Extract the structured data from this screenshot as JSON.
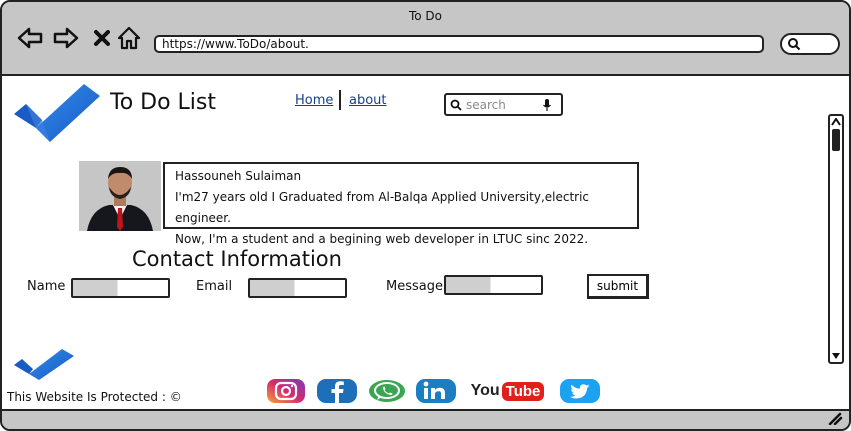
{
  "window": {
    "title": "To Do",
    "url": "https://www.ToDo/about."
  },
  "site": {
    "title": "To Do List",
    "nav": [
      {
        "label": "Home"
      },
      {
        "label": "about"
      }
    ],
    "search_placeholder": "search"
  },
  "profile": {
    "name": "Hassouneh Sulaiman",
    "line1": "I'm27 years old I Graduated from Al-Balqa Applied University,electric engineer.",
    "line2": "Now, I'm a student and a begining web developer in LTUC sinc 2022."
  },
  "contact": {
    "heading": "Contact Information",
    "name_label": "Name",
    "email_label": "Email",
    "message_label": "Message",
    "submit_label": "submit"
  },
  "footer": {
    "text": "This Website Is Protected : ©",
    "youtube_you": "You",
    "youtube_tube": "Tube"
  },
  "colors": {
    "chrome": "#c6c6c6",
    "link": "#1a3f8a",
    "instagram": "#d6286e",
    "facebook": "#1d6fb8",
    "whatsapp": "#3aa651",
    "linkedin": "#1b7ec2",
    "youtube": "#e0211b",
    "twitter": "#1da1f2"
  },
  "icons": [
    "back-icon",
    "forward-icon",
    "close-icon",
    "home-icon",
    "search-icon",
    "microphone-icon",
    "instagram-icon",
    "facebook-icon",
    "whatsapp-icon",
    "linkedin-icon",
    "youtube-icon",
    "twitter-icon"
  ]
}
